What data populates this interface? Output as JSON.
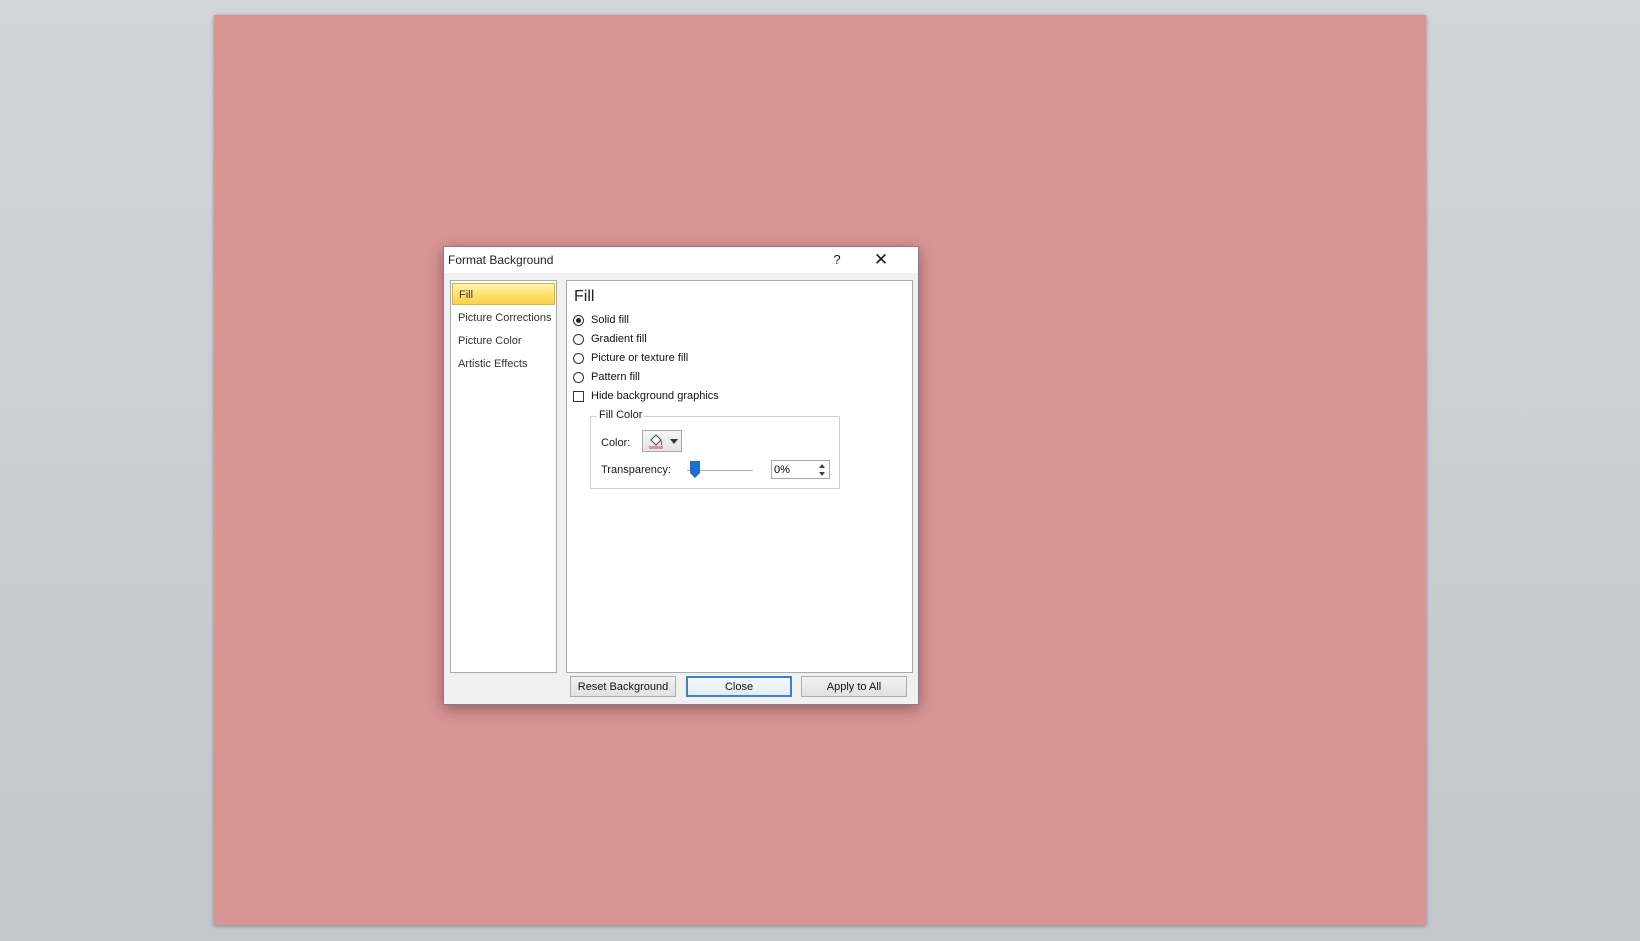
{
  "dialog": {
    "title": "Format Background",
    "help_label": "?",
    "close_label": "✕"
  },
  "nav": {
    "items": [
      {
        "label": "Fill",
        "selected": true
      },
      {
        "label": "Picture Corrections",
        "selected": false
      },
      {
        "label": "Picture Color",
        "selected": false
      },
      {
        "label": "Artistic Effects",
        "selected": false
      }
    ]
  },
  "fill": {
    "title": "Fill",
    "options": [
      {
        "label": "Solid fill",
        "checked": true
      },
      {
        "label": "Gradient fill",
        "checked": false
      },
      {
        "label": "Picture or texture fill",
        "checked": false
      },
      {
        "label": "Pattern fill",
        "checked": false
      }
    ],
    "hide_graphics": {
      "label": "Hide background graphics",
      "checked": false
    },
    "fill_color": {
      "group_label": "Fill Color",
      "color_label": "Color:",
      "color_value": "#d99594",
      "transparency_label": "Transparency:",
      "transparency_value": "0%",
      "transparency_level": 0
    }
  },
  "buttons": {
    "reset": "Reset Background",
    "close": "Close",
    "apply_all": "Apply to All"
  },
  "colors": {
    "slide_background": "#d99594",
    "accent": "#3c7fd6",
    "selected_nav": "#fde26b"
  }
}
